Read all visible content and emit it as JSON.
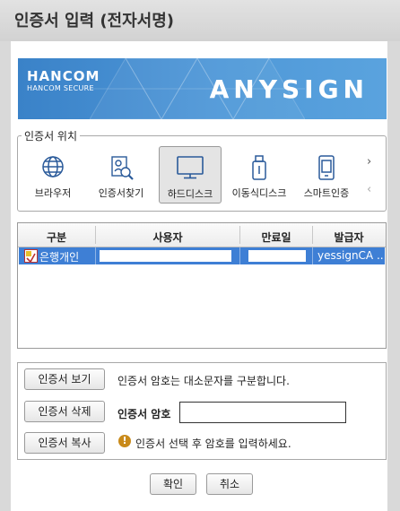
{
  "window": {
    "title": "인증서 입력 (전자서명)"
  },
  "banner": {
    "logo_main": "HANCOM",
    "logo_sub": "HANCOM SECURE",
    "brand": "ANYSIGN"
  },
  "location": {
    "legend": "인증서 위치",
    "items": [
      {
        "label": "브라우저",
        "icon": "globe-icon",
        "selected": false
      },
      {
        "label": "인증서찾기",
        "icon": "certificate-search-icon",
        "selected": false
      },
      {
        "label": "하드디스크",
        "icon": "monitor-icon",
        "selected": true
      },
      {
        "label": "이동식디스크",
        "icon": "usb-drive-icon",
        "selected": false
      },
      {
        "label": "스마트인증",
        "icon": "smartphone-icon",
        "selected": false
      }
    ]
  },
  "cert_table": {
    "headers": [
      "구분",
      "사용자",
      "만료일",
      "발급자"
    ],
    "rows": [
      {
        "type": "은행개인",
        "user": "",
        "expiry": "",
        "issuer": "yessignCA ..."
      }
    ]
  },
  "actions": {
    "view": "인증서 보기",
    "delete": "인증서 삭제",
    "copy": "인증서 복사",
    "case_note": "인증서 암호는 대소문자를 구분합니다.",
    "password_label": "인증서 암호",
    "password_value": "",
    "hint": "인증서 선택 후 암호를 입력하세요."
  },
  "footer": {
    "ok": "확인",
    "cancel": "취소"
  },
  "colors": {
    "banner": "#4a90d2",
    "selection": "#3e7fd5"
  }
}
